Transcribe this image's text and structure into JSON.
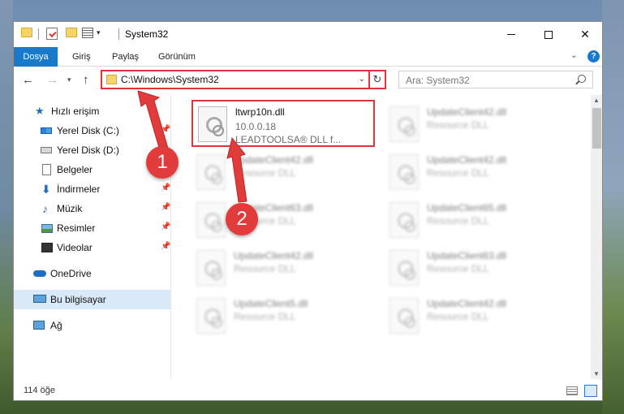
{
  "window": {
    "title": "System32"
  },
  "ribbon": {
    "tabs": [
      "Dosya",
      "Giriş",
      "Paylaş",
      "Görünüm"
    ]
  },
  "navigation": {
    "address": "C:\\Windows\\System32",
    "search_placeholder": "Ara: System32"
  },
  "sidebar": {
    "items": [
      {
        "label": "Hızlı erişim",
        "icon": "star-icon"
      },
      {
        "label": "Yerel Disk (C:)",
        "icon": "disk-icon",
        "pinned": true
      },
      {
        "label": "Yerel Disk (D:)",
        "icon": "disk-icon"
      },
      {
        "label": "Belgeler",
        "icon": "document-icon",
        "pinned": true
      },
      {
        "label": "İndirmeler",
        "icon": "download-icon",
        "pinned": true
      },
      {
        "label": "Müzik",
        "icon": "music-icon",
        "pinned": true
      },
      {
        "label": "Resimler",
        "icon": "pictures-icon",
        "pinned": true
      },
      {
        "label": "Videolar",
        "icon": "video-icon",
        "pinned": true
      },
      {
        "label": "OneDrive",
        "icon": "cloud-icon"
      },
      {
        "label": "Bu bilgisayar",
        "icon": "computer-icon",
        "selected": true
      },
      {
        "label": "Ağ",
        "icon": "network-icon"
      }
    ]
  },
  "files": [
    {
      "name": "ltwrp10n.dll",
      "line2": "10.0.0.18",
      "line3": "LEADTOOLSA® DLL f...",
      "highlighted": true
    },
    {
      "name": "UpdateClient42.dll",
      "line2": "Resource DLL"
    },
    {
      "name": "UpdateClient42.dll",
      "line2": "Resource DLL"
    },
    {
      "name": "UpdateClient42.dll",
      "line2": "Resource DLL"
    },
    {
      "name": "UpdateClient63.dll",
      "line2": "Resource DLL"
    },
    {
      "name": "UpdateClient65.dll",
      "line2": "Resource DLL"
    },
    {
      "name": "UpdateClient42.dll",
      "line2": "Resource DLL"
    },
    {
      "name": "UpdateClient63.dll",
      "line2": "Resource DLL"
    },
    {
      "name": "UpdateClient5.dll",
      "line2": "Resource DLL"
    },
    {
      "name": "UpdateClient42.dll",
      "line2": "Resource DLL"
    }
  ],
  "status": {
    "count": "114 öğe"
  },
  "annotations": {
    "step1": "1",
    "step2": "2",
    "color": "#e23b3b"
  }
}
